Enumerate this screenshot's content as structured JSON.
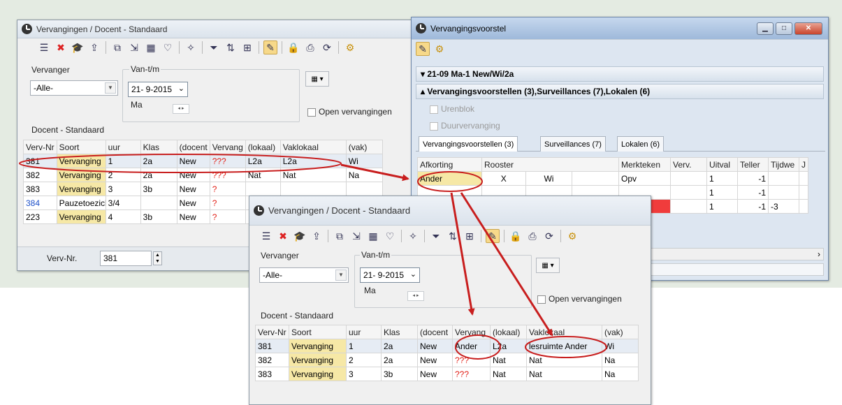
{
  "win1": {
    "title": "Vervangingen / Docent - Standaard",
    "vervanger_label": "Vervanger",
    "vervanger_value": "-Alle-",
    "vantm_label": "Van-t/m",
    "date_value": "21- 9-2015",
    "day": "Ma",
    "open_label": "Open vervangingen",
    "docent_label": "Docent - Standaard",
    "headers": [
      "Verv-Nr",
      "Soort",
      "uur",
      "Klas",
      "(docent",
      "Vervang",
      "(lokaal)",
      "Vaklokaal",
      "(vak)"
    ],
    "rows": [
      [
        "381",
        "Vervanging",
        "1",
        "2a",
        "New",
        "???",
        "L2a",
        "L2a",
        "Wi"
      ],
      [
        "382",
        "Vervanging",
        "2",
        "2a",
        "New",
        "???",
        "Nat",
        "Nat",
        "Na"
      ],
      [
        "383",
        "Vervanging",
        "3",
        "3b",
        "New",
        "?",
        "",
        "",
        ""
      ],
      [
        "384",
        "Pauzetoezicht",
        "3/4",
        "",
        "New",
        "?",
        "",
        "",
        ""
      ],
      [
        "223",
        "Vervanging",
        "4",
        "3b",
        "New",
        "?",
        "",
        "",
        ""
      ]
    ],
    "vervnr_label": "Verv-Nr.",
    "vervnr_value": "381"
  },
  "win2": {
    "title": "Vervangingsvoorstel",
    "section1": "▾ 21-09 Ma-1 New/Wi/2a",
    "section2": "▴ Vervangingsvoorstellen (3),Surveillances (7),Lokalen (6)",
    "urenblok": "Urenblok",
    "duur": "Duurvervanging",
    "tabs": [
      "Vervangingsvoorstellen (3)",
      "Surveillances (7)",
      "Lokalen (6)"
    ],
    "headers": [
      "Afkorting",
      "Rooster",
      "Merkteken",
      "Verv.",
      "Uitval",
      "Teller",
      "Tijdwe",
      "J"
    ],
    "row1": {
      "afk": "Ander",
      "x": "X",
      "wi": "Wi",
      "merk": "Opv",
      "uitval": "1",
      "teller": "-1"
    },
    "row2": {
      "uitval": "1",
      "teller": "-1"
    },
    "row3": {
      "uitval": "1",
      "teller": "-1",
      "tijd": "-3"
    }
  },
  "win3": {
    "title": "Vervangingen / Docent - Standaard",
    "vervanger_label": "Vervanger",
    "vervanger_value": "-Alle-",
    "vantm_label": "Van-t/m",
    "date_value": "21- 9-2015",
    "day": "Ma",
    "open_label": "Open vervangingen",
    "docent_label": "Docent - Standaard",
    "headers": [
      "Verv-Nr",
      "Soort",
      "uur",
      "Klas",
      "(docent",
      "Vervang",
      "(lokaal)",
      "Vaklokaal",
      "(vak)"
    ],
    "rows": [
      [
        "381",
        "Vervanging",
        "1",
        "2a",
        "New",
        "Ander",
        "L2a",
        "lesruimte Ander",
        "Wi"
      ],
      [
        "382",
        "Vervanging",
        "2",
        "2a",
        "New",
        "???",
        "Nat",
        "Nat",
        "Na"
      ],
      [
        "383",
        "Vervanging",
        "3",
        "3b",
        "New",
        "???",
        "Nat",
        "Nat",
        "Na"
      ]
    ]
  },
  "colors": {
    "annotation": "#c81e1e",
    "selected_row": "#f6e8a6",
    "header_sel": "#f4d792"
  }
}
